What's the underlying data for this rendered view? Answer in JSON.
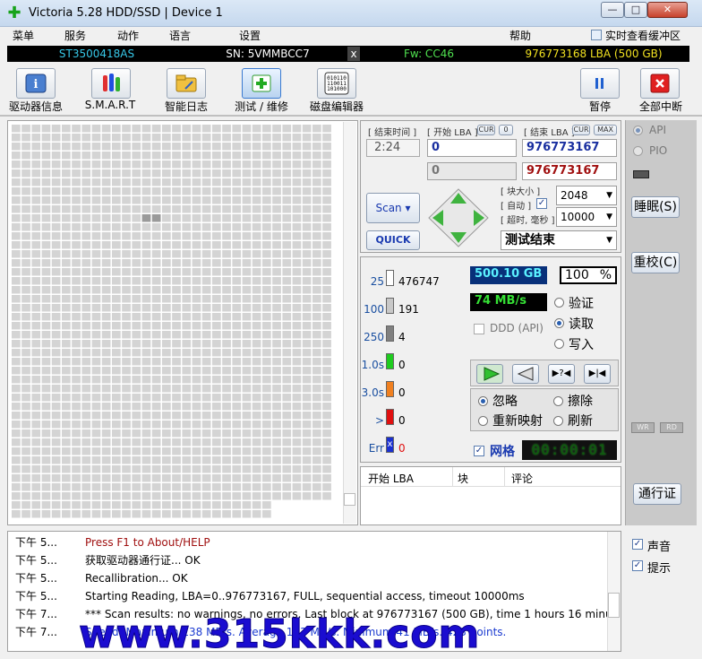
{
  "window": {
    "title": "Victoria 5.28 HDD/SSD | Device 1",
    "min": "—",
    "max": "□",
    "close": "✕"
  },
  "menu": {
    "items": [
      "菜单",
      "服务",
      "动作",
      "语言",
      "设置",
      "帮助"
    ],
    "realtime_label": "实时查看缓冲区"
  },
  "device": {
    "model": "ST3500418AS",
    "serial": "SN: 5VMMBCC7",
    "close": "x",
    "firmware": "Fw: CC46",
    "capacity": "976773168 LBA (500 GB)"
  },
  "toolbar": {
    "drive_info": "驱动器信息",
    "smart": "S.M.A.R.T",
    "smart_log": "智能日志",
    "test_repair": "测试 / 维修",
    "disk_editor": "磁盘编辑器",
    "pause": "暂停",
    "abort_all": "全部中断"
  },
  "scan": {
    "end_time_label": "结束时间",
    "end_time_value": "2:24",
    "start_lba_label": "开始 LBA",
    "cur_label": "CUR",
    "zero_label": "0",
    "start_lba_value": "0",
    "start_lba_value2": "0",
    "end_lba_label": "结束 LBA",
    "end_cur_label": "CUR",
    "max_label": "MAX",
    "end_lba_value": "976773167",
    "end_lba_value2": "976773167",
    "scan_button": "Scan",
    "quick_button": "QUICK",
    "block_size_label": "块大小",
    "auto_label": "自动",
    "block_size_value": "2048",
    "timeout_label": "超时, 毫秒",
    "timeout_value": "10000",
    "status_value": "测试结束"
  },
  "stats": {
    "rows": [
      {
        "label": "25",
        "value": "476747",
        "color": "#ffffff"
      },
      {
        "label": "100",
        "value": "191",
        "color": "#c8c8c8"
      },
      {
        "label": "250",
        "value": "4",
        "color": "#808080"
      },
      {
        "label": "1.0s",
        "value": "0",
        "color": "#1ecb1e"
      },
      {
        "label": "3.0s",
        "value": "0",
        "color": "#f08020"
      },
      {
        "label": ">",
        "value": "0",
        "color": "#e01010"
      },
      {
        "label": "Err",
        "value": "0",
        "color": "#1a30d0"
      }
    ],
    "err_mark": "x",
    "processed": "500.10 GB",
    "percent": "100",
    "percent_sign": "%",
    "speed": "74 MB/s",
    "ddd_label": "DDD (API)",
    "verify_label": "验证",
    "read_label": "读取",
    "write_label": "写入",
    "ignore_label": "忽略",
    "erase_label": "擦除",
    "remap_label": "重新映射",
    "refresh_label": "刷新",
    "grid_label": "网格",
    "timer": "00:00:01"
  },
  "table": {
    "columns": [
      "开始 LBA",
      "块",
      "评论"
    ]
  },
  "side": {
    "api_label": "API",
    "pio_label": "PIO",
    "sleep_button": "睡眠(S)",
    "recal_button": "重校(C)",
    "wr_label": "WR",
    "rd_label": "RD",
    "passport_button": "通行证"
  },
  "log": {
    "rows": [
      {
        "time": "下午 5...",
        "text": "Press F1 to About/HELP",
        "color": "#a01010"
      },
      {
        "time": "下午 5...",
        "text": "获取驱动器通行证... OK",
        "color": "#000000"
      },
      {
        "time": "下午 5...",
        "text": "Recallibration... OK",
        "color": "#000000"
      },
      {
        "time": "下午 5...",
        "text": "Starting Reading, LBA=0..976773167, FULL, sequential access, timeout 10000ms",
        "color": "#000000"
      },
      {
        "time": "下午 7...",
        "text": "*** Scan results: no warnings, no errors. Last block at 976773167 (500 GB), time 1 hours 16 minu...",
        "color": "#000000"
      },
      {
        "time": "下午 7...",
        "text": "Speed: Maximum 138 MB/s. Average 103 MB/s. Minimum 41 MB/s. 423 points.",
        "color": "#1a3ad0"
      }
    ],
    "sound_label": "声音",
    "hints_label": "提示"
  },
  "watermark": "www.315kkk.com"
}
